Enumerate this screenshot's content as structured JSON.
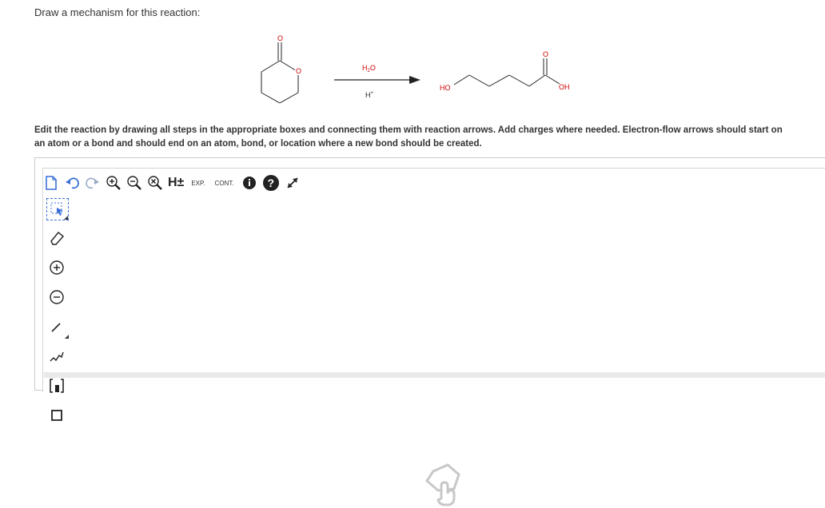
{
  "question": {
    "prompt": "Draw a mechanism for this reaction:",
    "instructions": "Edit the reaction by drawing all steps in the appropriate boxes and connecting them with reaction arrows. Add charges where needed. Electron-flow arrows should start on an atom or a bond and should end on an atom, bond, or location where a new bond should be created."
  },
  "reaction": {
    "reactant_atoms": {
      "ring_o": "O",
      "carbonyl_o": "O"
    },
    "reagent_top": "H2O",
    "reagent_bottom": "H+",
    "product_atoms": {
      "left_oh": "HO",
      "right_oh": "OH",
      "carbonyl_o": "O"
    }
  },
  "toolbar": {
    "h_label": "H±",
    "exp_label": "EXP.",
    "cont_label": "CONT."
  },
  "colors": {
    "accent_blue": "#3a6fd8",
    "heteroatom_red": "#cc0000",
    "icon_dark": "#222222"
  }
}
